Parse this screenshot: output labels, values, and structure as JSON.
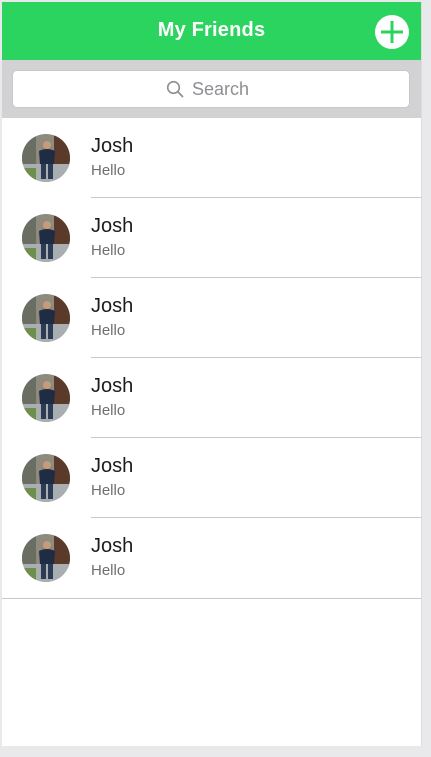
{
  "navbar": {
    "title": "My Friends",
    "add_icon": "plus-circle-icon",
    "color": "#2bd35f"
  },
  "search": {
    "placeholder": "Search",
    "icon": "search-icon"
  },
  "friends": [
    {
      "name": "Josh",
      "message": "Hello"
    },
    {
      "name": "Josh",
      "message": "Hello"
    },
    {
      "name": "Josh",
      "message": "Hello"
    },
    {
      "name": "Josh",
      "message": "Hello"
    },
    {
      "name": "Josh",
      "message": "Hello"
    },
    {
      "name": "Josh",
      "message": "Hello"
    }
  ]
}
